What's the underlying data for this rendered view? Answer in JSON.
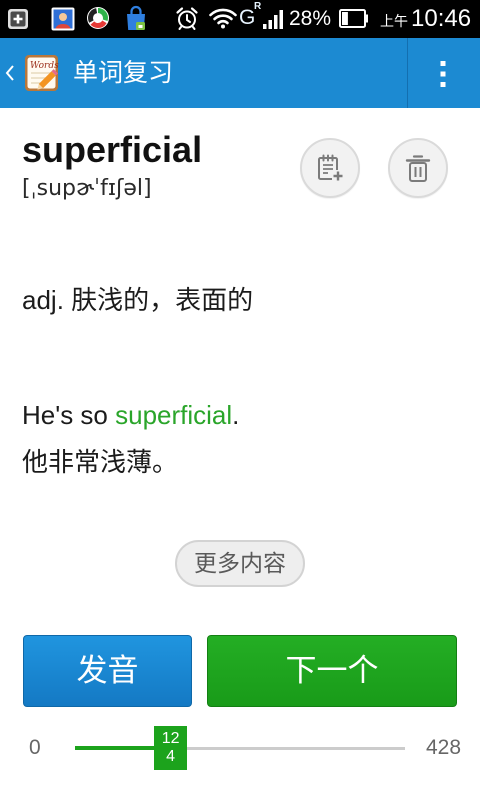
{
  "status_bar": {
    "notification_icons": [
      "add-box-icon",
      "contact-photo-icon",
      "swirl-app-icon",
      "shopping-bag-icon"
    ],
    "system_icons": [
      "alarm-icon",
      "wifi-icon",
      "signal-icon",
      "battery-icon"
    ],
    "network_type": "G",
    "roaming_indicator": "R",
    "battery_percent": "28%",
    "time_period": "上午",
    "time": "10:46"
  },
  "action_bar": {
    "back_icon": "chevron-left-icon",
    "app_icon": "words-notebook-icon",
    "app_icon_lettering": "Words",
    "title": "单词复习",
    "overflow_icon": "more-vert-icon"
  },
  "word": {
    "headword": "superficial",
    "phonetic": "[ˌsupɚˈfɪʃəl]",
    "add_note_icon": "note-add-icon",
    "delete_icon": "trash-icon",
    "definition": "adj. 肤浅的，表面的",
    "example": {
      "before": "He's so ",
      "highlight": "superficial",
      "after": "."
    },
    "translation": "他非常浅薄。",
    "more_label": "更多内容"
  },
  "controls": {
    "pronounce_label": "发音",
    "next_label": "下一个"
  },
  "progress": {
    "min": 0,
    "max": 428,
    "current": 124
  },
  "colors": {
    "status_bar": "#000000",
    "action_bar": "#1c8ad2",
    "highlight_text": "#2aa52a",
    "pronounce_button": "#1a87cf",
    "next_button": "#1fa51f",
    "slider_fill": "#1ca31c",
    "slider_track": "#cccccc"
  }
}
